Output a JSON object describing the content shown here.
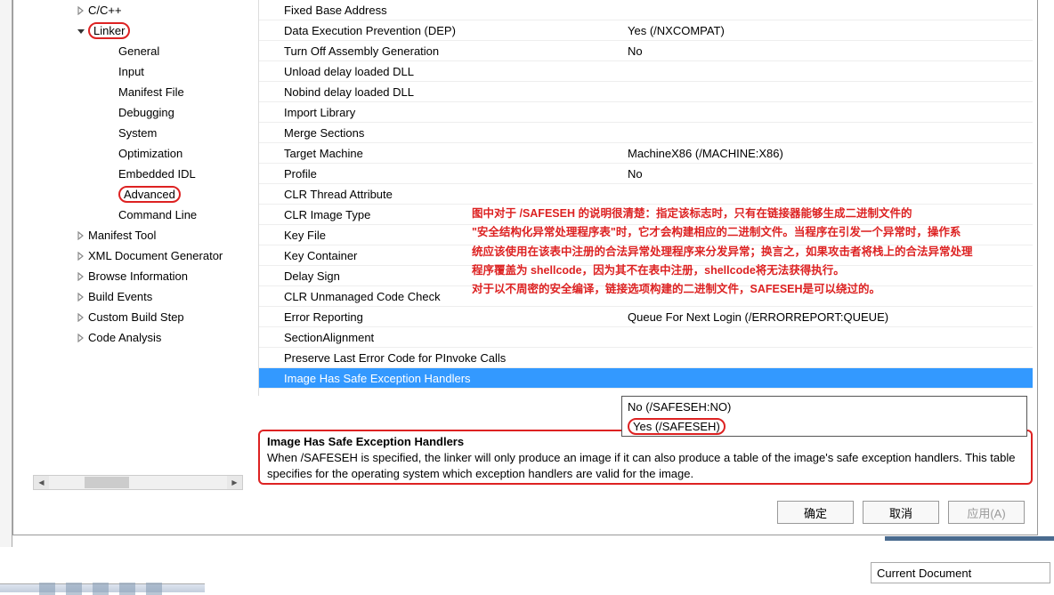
{
  "tree": {
    "items": [
      {
        "indent": 48,
        "arrow": "right",
        "label": "C/C++"
      },
      {
        "indent": 48,
        "arrow": "down",
        "label": "Linker",
        "highlight": true
      },
      {
        "indent": 82,
        "arrow": "",
        "label": "General"
      },
      {
        "indent": 82,
        "arrow": "",
        "label": "Input"
      },
      {
        "indent": 82,
        "arrow": "",
        "label": "Manifest File"
      },
      {
        "indent": 82,
        "arrow": "",
        "label": "Debugging"
      },
      {
        "indent": 82,
        "arrow": "",
        "label": "System"
      },
      {
        "indent": 82,
        "arrow": "",
        "label": "Optimization"
      },
      {
        "indent": 82,
        "arrow": "",
        "label": "Embedded IDL"
      },
      {
        "indent": 82,
        "arrow": "",
        "label": "Advanced",
        "highlight": true
      },
      {
        "indent": 82,
        "arrow": "",
        "label": "Command Line"
      },
      {
        "indent": 48,
        "arrow": "right",
        "label": "Manifest Tool"
      },
      {
        "indent": 48,
        "arrow": "right",
        "label": "XML Document Generator"
      },
      {
        "indent": 48,
        "arrow": "right",
        "label": "Browse Information"
      },
      {
        "indent": 48,
        "arrow": "right",
        "label": "Build Events"
      },
      {
        "indent": 48,
        "arrow": "right",
        "label": "Custom Build Step"
      },
      {
        "indent": 48,
        "arrow": "right",
        "label": "Code Analysis"
      }
    ]
  },
  "props": [
    {
      "name": "Fixed Base Address",
      "value": ""
    },
    {
      "name": "Data Execution Prevention (DEP)",
      "value": "Yes (/NXCOMPAT)"
    },
    {
      "name": "Turn Off Assembly Generation",
      "value": "No"
    },
    {
      "name": "Unload delay loaded DLL",
      "value": ""
    },
    {
      "name": "Nobind delay loaded DLL",
      "value": ""
    },
    {
      "name": "Import Library",
      "value": ""
    },
    {
      "name": "Merge Sections",
      "value": ""
    },
    {
      "name": "Target Machine",
      "value": "MachineX86 (/MACHINE:X86)"
    },
    {
      "name": "Profile",
      "value": "No"
    },
    {
      "name": "CLR Thread Attribute",
      "value": ""
    },
    {
      "name": "CLR Image Type",
      "value": ""
    },
    {
      "name": "Key File",
      "value": ""
    },
    {
      "name": "Key Container",
      "value": ""
    },
    {
      "name": "Delay Sign",
      "value": ""
    },
    {
      "name": "CLR Unmanaged Code Check",
      "value": ""
    },
    {
      "name": "Error Reporting",
      "value": "Queue For Next Login (/ERRORREPORT:QUEUE)"
    },
    {
      "name": "SectionAlignment",
      "value": ""
    },
    {
      "name": "Preserve Last Error Code for PInvoke Calls",
      "value": ""
    },
    {
      "name": "Image Has Safe Exception Handlers",
      "value": "",
      "selected": true
    }
  ],
  "dropdown": {
    "items": [
      {
        "label": "No (/SAFESEH:NO)"
      },
      {
        "label": "Yes (/SAFESEH)",
        "highlight": true
      }
    ]
  },
  "desc": {
    "title": "Image Has Safe Exception Handlers",
    "text": "When /SAFESEH is specified, the linker will only produce an image if it can also produce a table of the image's safe exception handlers. This table specifies for the operating system which exception handlers are valid for the image."
  },
  "buttons": {
    "ok": "确定",
    "cancel": "取消",
    "apply": "应用(A)"
  },
  "annotation": {
    "line1": "图中对于 /SAFESEH 的说明很清楚：指定该标志时，只有在链接器能够生成二进制文件的",
    "line2": "\"安全结构化异常处理程序表\"时，它才会构建相应的二进制文件。当程序在引发一个异常时，操作系",
    "line3": "统应该使用在该表中注册的合法异常处理程序来分发异常；换言之，如果攻击者将栈上的合法异常处理",
    "line4": "程序覆盖为 shellcode，因为其不在表中注册，shellcode将无法获得执行。",
    "line5": "对于以不周密的安全编译，链接选项构建的二进制文件，SAFESEH是可以绕过的。"
  },
  "statusbar": {
    "dropdown": "Current Document"
  }
}
